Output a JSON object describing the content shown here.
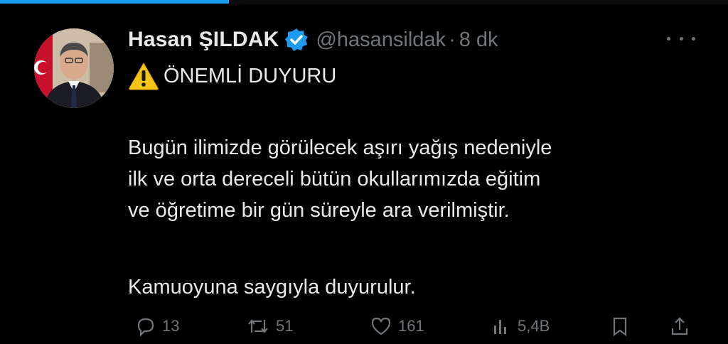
{
  "tweet": {
    "author": {
      "name": "Hasan ŞILDAK",
      "handle": "@hasansildak",
      "separator": "·",
      "time": "8 dk",
      "verified": true
    },
    "title": "ÖNEMLİ DUYURU",
    "title_icon": "warning-icon",
    "paragraph1": [
      "Bugün ilimizde görülecek aşırı yağış nedeniyle",
      "ilk ve orta dereceli bütün okullarımızda eğitim",
      "ve öğretime bir gün süreyle ara verilmiştir."
    ],
    "paragraph2": "Kamuoyuna saygıyla duyurulur.",
    "stats": {
      "replies": "13",
      "reposts": "51",
      "likes": "161",
      "views": "5,4B"
    }
  },
  "colors": {
    "background": "#000000",
    "text": "#e7e9ea",
    "muted": "#71767b",
    "accent": "#1d9bf0",
    "warning": "#f5c518"
  }
}
